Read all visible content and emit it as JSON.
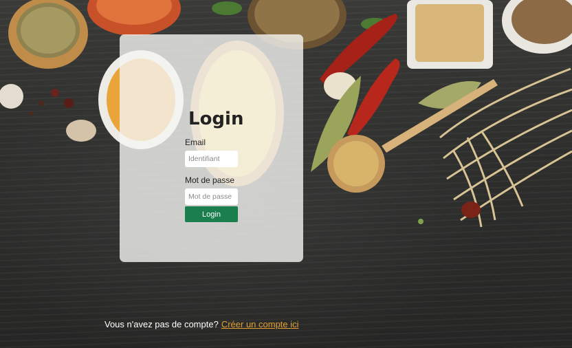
{
  "login": {
    "title": "Login",
    "email_label": "Email",
    "email_placeholder": "Identifiant",
    "email_value": "",
    "password_label": "Mot de passe",
    "password_placeholder": "Mot de passe",
    "password_value": "",
    "submit_label": "Login"
  },
  "signup": {
    "prompt": "Vous n'avez pas de compte?",
    "link_text": "Créer un compte ici"
  },
  "colors": {
    "accent_button": "#1a7e4d",
    "link": "#e4a032",
    "background": "#2f2f2e"
  },
  "background_image": {
    "icons": [
      "spice-bowl-icon",
      "chili-pepper-icon",
      "wooden-spoon-icon",
      "garlic-icon",
      "bay-leaf-icon",
      "dried-noodles-icon"
    ]
  }
}
